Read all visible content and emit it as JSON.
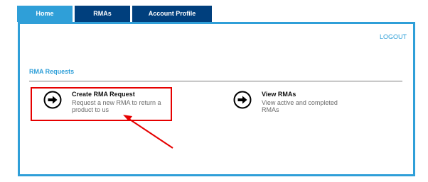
{
  "tabs": [
    {
      "label": "Home",
      "active": true
    },
    {
      "label": "RMAs",
      "active": false
    },
    {
      "label": "Account Profile",
      "active": false
    }
  ],
  "header": {
    "logout_label": "LOGOUT"
  },
  "section": {
    "title": "RMA Requests"
  },
  "options": [
    {
      "title": "Create RMA Request",
      "description": "Request a new RMA to return a product to us",
      "icon": "arrow-circle-icon"
    },
    {
      "title": "View RMAs",
      "description": "View active and completed RMAs",
      "icon": "arrow-circle-icon"
    }
  ],
  "colors": {
    "tab_active": "#2f9fd8",
    "tab_inactive": "#003f7d",
    "panel_border": "#2f9fd8",
    "accent_text": "#2f9fd8",
    "annotation": "#e60000"
  }
}
